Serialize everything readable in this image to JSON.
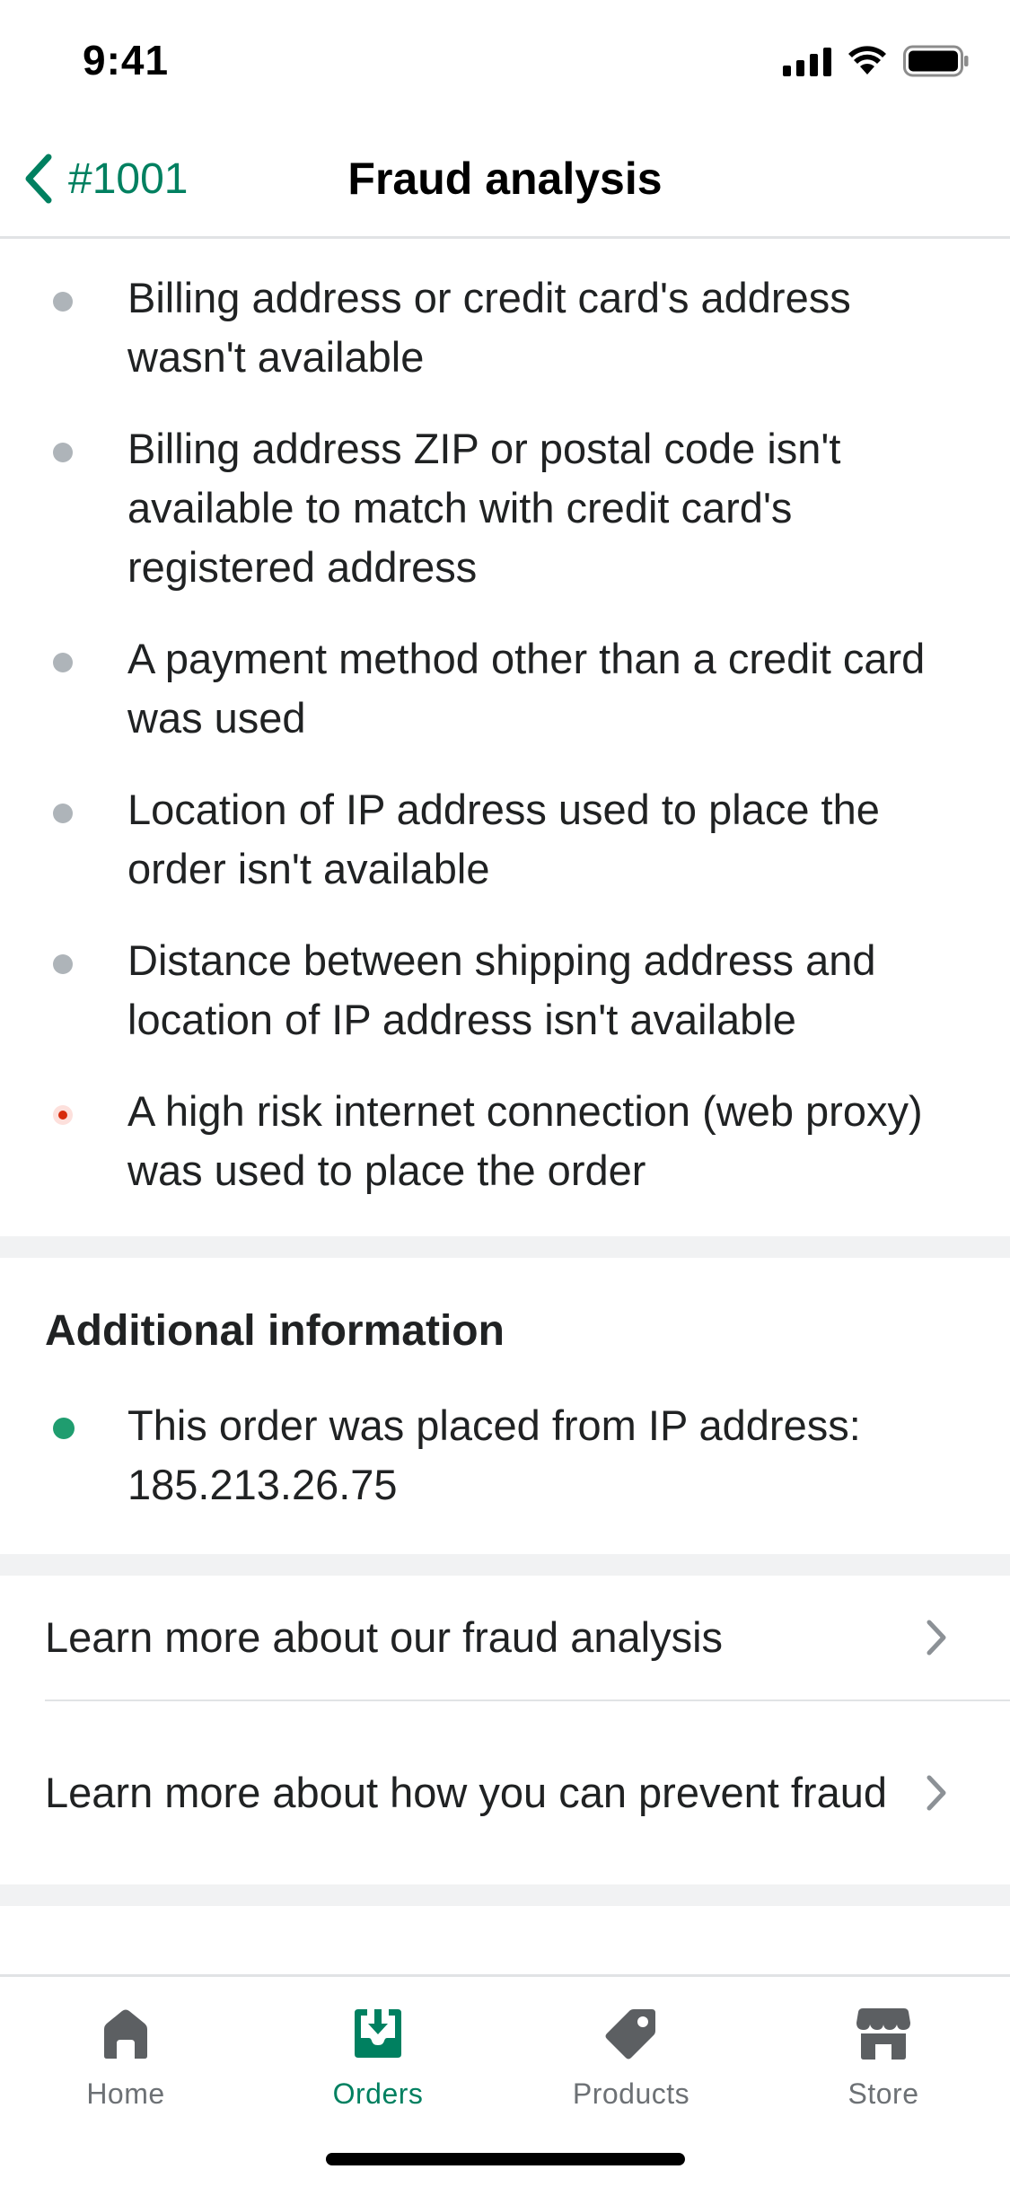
{
  "status_bar": {
    "time": "9:41"
  },
  "nav": {
    "back_label": "#1001",
    "title": "Fraud analysis"
  },
  "reasons": [
    {
      "text": "Billing address or credit card's address wasn't available",
      "level": "neutral"
    },
    {
      "text": "Billing address ZIP or postal code isn't available to match with credit card's registered address",
      "level": "neutral"
    },
    {
      "text": "A payment method other than a credit card was used",
      "level": "neutral"
    },
    {
      "text": "Location of IP address used to place the order isn't available",
      "level": "neutral"
    },
    {
      "text": "Distance between shipping address and location of IP address isn't available",
      "level": "neutral"
    },
    {
      "text": "A high risk internet connection (web proxy) was used to place the order",
      "level": "high-risk"
    }
  ],
  "additional": {
    "title": "Additional information",
    "items": [
      {
        "text": "This order was placed from IP address: 185.213.26.75",
        "level": "positive"
      }
    ]
  },
  "links": [
    {
      "label": "Learn more about our fraud analysis"
    },
    {
      "label": "Learn more about how you can prevent fraud"
    }
  ],
  "tabs": [
    {
      "label": "Home",
      "icon": "home-icon",
      "active": false
    },
    {
      "label": "Orders",
      "icon": "orders-icon",
      "active": true
    },
    {
      "label": "Products",
      "icon": "tag-icon",
      "active": false
    },
    {
      "label": "Store",
      "icon": "store-icon",
      "active": false
    }
  ],
  "colors": {
    "accent": "#008060",
    "neutral_dot": "#aeb4b9",
    "risk_dot": "#d72c0d",
    "positive_dot": "#1f9d6f",
    "inactive_tab": "#6d7175"
  }
}
